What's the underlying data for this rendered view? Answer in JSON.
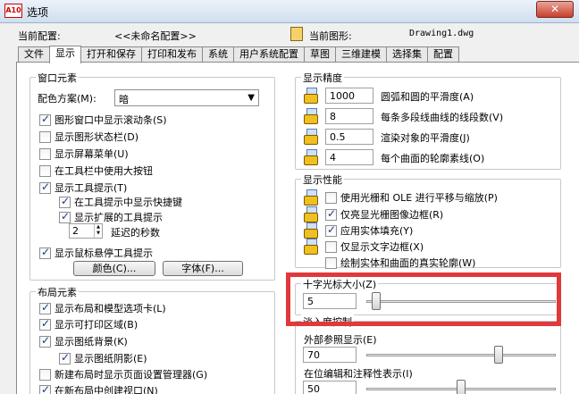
{
  "window": {
    "title": "选项",
    "app_icon": "A10",
    "close": "✕"
  },
  "profile": {
    "label": "当前配置:",
    "value": "<<未命名配置>>"
  },
  "drawing": {
    "label": "当前图形:",
    "value": "Drawing1.dwg"
  },
  "tabs": [
    "文件",
    "显示",
    "打开和保存",
    "打印和发布",
    "系统",
    "用户系统配置",
    "草图",
    "三维建模",
    "选择集",
    "配置"
  ],
  "active_tab": "显示",
  "window_elements": {
    "title": "窗口元素",
    "color_scheme_label": "配色方案(M):",
    "color_scheme_value": "暗",
    "checkboxes": [
      {
        "label": "图形窗口中显示滚动条(S)",
        "checked": true
      },
      {
        "label": "显示图形状态栏(D)",
        "checked": false
      },
      {
        "label": "显示屏幕菜单(U)",
        "checked": false
      },
      {
        "label": "在工具栏中使用大按钮",
        "checked": false
      },
      {
        "label": "显示工具提示(T)",
        "checked": true
      },
      {
        "label": "在工具提示中显示快捷键",
        "checked": true
      },
      {
        "label": "显示扩展的工具提示",
        "checked": true
      },
      {
        "label": "显示鼠标悬停工具提示",
        "checked": true
      }
    ],
    "delay_value": "2",
    "delay_label": "延迟的秒数",
    "colors_button": "颜色(C)...",
    "fonts_button": "字体(F)..."
  },
  "layout_elements": {
    "title": "布局元素",
    "checkboxes": [
      {
        "label": "显示布局和模型选项卡(L)",
        "checked": true
      },
      {
        "label": "显示可打印区域(B)",
        "checked": true
      },
      {
        "label": "显示图纸背景(K)",
        "checked": true
      },
      {
        "label": "显示图纸阴影(E)",
        "checked": true
      },
      {
        "label": "新建布局时显示页面设置管理器(G)",
        "checked": false
      },
      {
        "label": "在新布局中创建视口(N)",
        "checked": true
      }
    ]
  },
  "display_resolution": {
    "title": "显示精度",
    "items": [
      {
        "value": "1000",
        "label": "圆弧和圆的平滑度(A)"
      },
      {
        "value": "8",
        "label": "每条多段线曲线的线段数(V)"
      },
      {
        "value": "0.5",
        "label": "渲染对象的平滑度(J)"
      },
      {
        "value": "4",
        "label": "每个曲面的轮廓素线(O)"
      }
    ]
  },
  "display_performance": {
    "title": "显示性能",
    "checkboxes": [
      {
        "label": "使用光栅和 OLE 进行平移与缩放(P)",
        "checked": false
      },
      {
        "label": "仅亮显光栅图像边框(R)",
        "checked": true
      },
      {
        "label": "应用实体填充(Y)",
        "checked": true
      },
      {
        "label": "仅显示文字边框(X)",
        "checked": false
      },
      {
        "label": "绘制实体和曲面的真实轮廓(W)",
        "checked": false
      }
    ]
  },
  "crosshair": {
    "label": "十字光标大小(Z)",
    "value": "5",
    "level_percent": 5
  },
  "fade_control": {
    "label": "淡入度控制"
  },
  "xref_display": {
    "label": "外部参照显示(E)",
    "value": "70",
    "level_percent": 70
  },
  "inplace_edit": {
    "label": "在位编辑和注释性表示(I)",
    "value": "50",
    "level_percent": 50
  },
  "colors": {
    "highlight": "#e0383b",
    "check": "#1d3c8a"
  }
}
